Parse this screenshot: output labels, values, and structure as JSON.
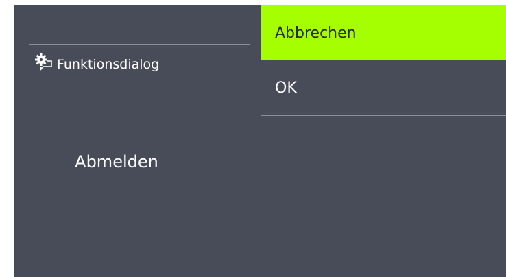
{
  "dialog": {
    "title": "Funktionsdialog",
    "icon": "gear-chat-icon",
    "main_label": "Abmelden"
  },
  "menu": {
    "items": [
      {
        "label": "Abbrechen",
        "selected": true
      },
      {
        "label": "OK",
        "selected": false
      }
    ]
  },
  "colors": {
    "background": "#474c58",
    "highlight": "#a6ff00",
    "text": "#ffffff"
  }
}
